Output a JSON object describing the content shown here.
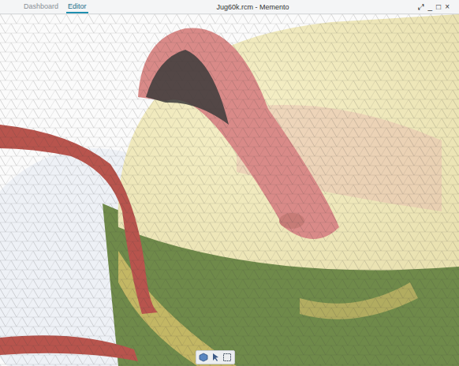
{
  "window": {
    "title": "Jug60k.rcm - Memento"
  },
  "tabs": [
    {
      "label": "Dashboard",
      "selected": false
    },
    {
      "label": "Editor",
      "selected": true
    }
  ],
  "window_controls": [
    "⤢",
    "_",
    "□",
    "×"
  ]
}
